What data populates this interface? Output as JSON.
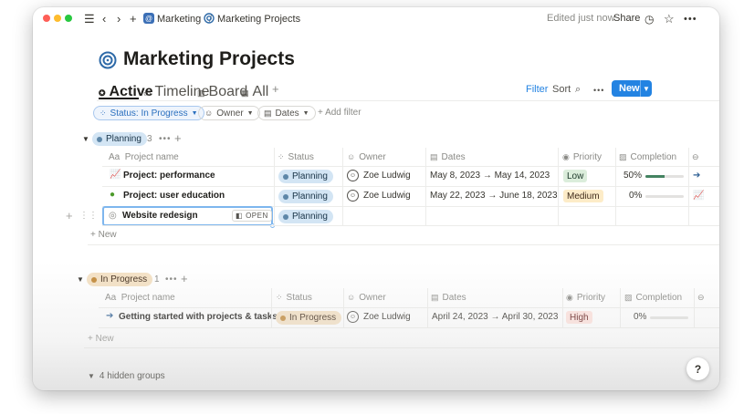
{
  "topbar": {
    "breadcrumb_workspace": "Marketing",
    "breadcrumb_sep": "/",
    "breadcrumb_page": "Marketing Projects",
    "edited": "Edited just now",
    "share": "Share"
  },
  "page": {
    "title": "Marketing Projects"
  },
  "views": {
    "tabs": [
      {
        "label": "Active"
      },
      {
        "label": "Timeline"
      },
      {
        "label": "Board"
      },
      {
        "label": "All"
      }
    ],
    "filter": "Filter",
    "sort": "Sort",
    "new": "New"
  },
  "filters": {
    "status": "Status: In Progress",
    "owner": "Owner",
    "dates": "Dates",
    "add": "+ Add filter"
  },
  "columns": [
    "Project name",
    "Status",
    "Owner",
    "Dates",
    "Priority",
    "Completion"
  ],
  "column_prefix": "Aa",
  "groups": [
    {
      "label": "Planning",
      "count": "3",
      "rows": [
        {
          "name": "Project: performance",
          "status": "Planning",
          "owner": "Zoe Ludwig",
          "dates": "May 8, 2023 → May 14, 2023",
          "priority": "Low",
          "completion": "50%",
          "completion_value": 0.5
        },
        {
          "name": "Project: user education",
          "status": "Planning",
          "owner": "Zoe Ludwig",
          "dates": "May 22, 2023 → June 18, 2023",
          "priority": "Medium",
          "completion": "0%",
          "completion_value": 0
        },
        {
          "name": "Website redesign",
          "status": "Planning",
          "open": "OPEN"
        }
      ]
    },
    {
      "label": "In Progress",
      "count": "1",
      "rows": [
        {
          "name": "Getting started with projects & tasks",
          "status": "In Progress",
          "owner": "Zoe Ludwig",
          "dates": "April 24, 2023 → April 30, 2023",
          "priority": "High",
          "completion": "0%",
          "completion_value": 0
        }
      ]
    }
  ],
  "new_row": "+ New",
  "hidden_groups": "4 hidden groups",
  "help": "?",
  "colors": {
    "accent": "#2383e2",
    "planning_bg": "#d3e5f4",
    "progress_bg": "#f4e1c4"
  }
}
